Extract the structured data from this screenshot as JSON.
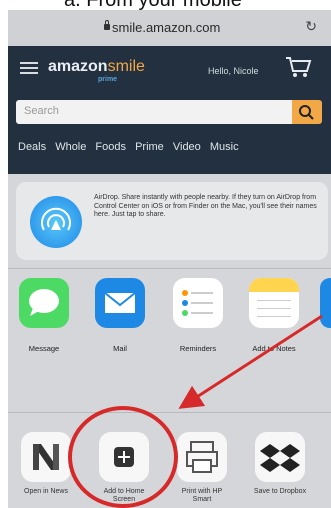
{
  "caption": {
    "text": "a. From your mobile"
  },
  "browser": {
    "url": "smile.amazon.com",
    "lock_icon": "lock-icon",
    "reload_icon": "reload-icon"
  },
  "amazon": {
    "logo_main": "amazon",
    "logo_smile": "smile",
    "logo_sub": "prime",
    "greeting": "Hello, Nicole",
    "search_placeholder": "Search",
    "nav_links": [
      "Deals",
      "Whole Foods",
      "Prime",
      "Video",
      "Music"
    ]
  },
  "share_sheet": {
    "airdrop_text": "AirDrop. Share instantly with people nearby. If they turn on AirDrop from Control Center on iOS or from Finder on the Mac, you'll see their names here. Just tap to share.",
    "apps": [
      {
        "label": "Message",
        "color": "#4cd964"
      },
      {
        "label": "Mail",
        "color": "#1e88e5"
      },
      {
        "label": "Reminders",
        "color": "#ffffff"
      },
      {
        "label": "Add to Notes",
        "color": "#ffffff"
      }
    ],
    "actions": [
      {
        "label": "Open in News"
      },
      {
        "label": "Add to Home Screen"
      },
      {
        "label": "Print with HP Smart"
      },
      {
        "label": "Save to Dropbox"
      }
    ]
  },
  "colors": {
    "annotation_red": "#d62a2a",
    "amazon_dark": "#22303f",
    "amazon_orange": "#f3a847"
  }
}
